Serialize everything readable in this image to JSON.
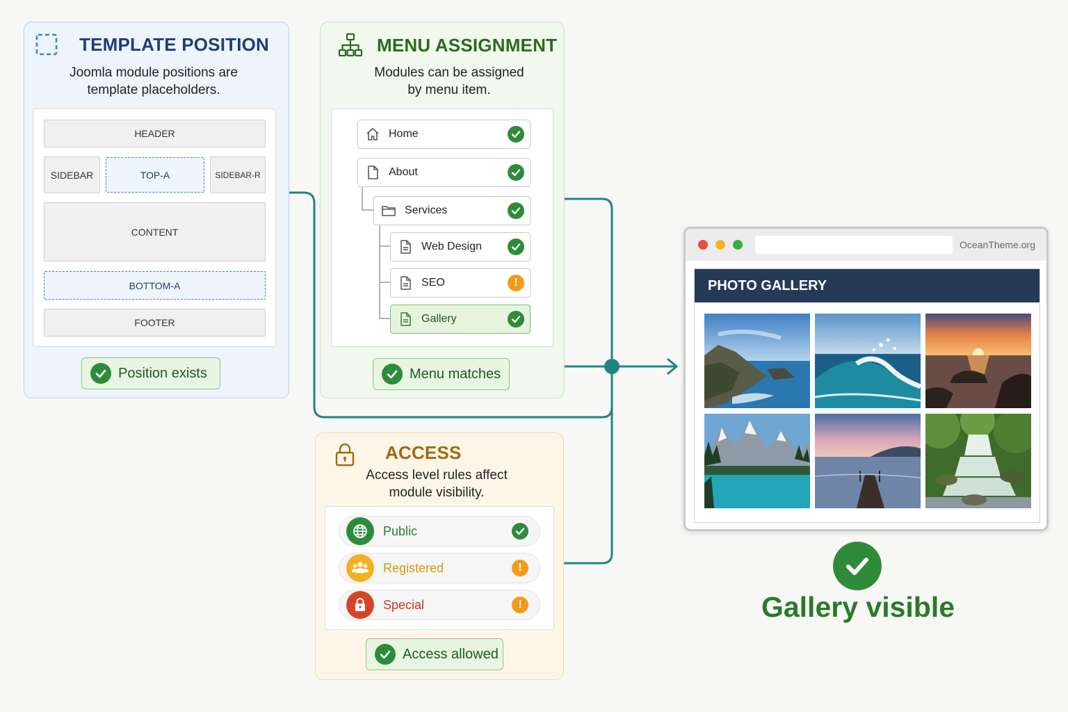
{
  "template_panel": {
    "title": "TEMPLATE POSITION",
    "description_line1": "Joomla module positions are",
    "description_line2": "template placeholders.",
    "slots": {
      "header": "HEADER",
      "sidebar": "SIDEBAR",
      "top_a": "TOP-A",
      "sidebar_r": "SIDEBAR-R",
      "content": "CONTENT",
      "bottom_a": "BOTTOM-A",
      "footer": "FOOTER"
    },
    "status": "Position exists",
    "color": "#1f3f72"
  },
  "menu_panel": {
    "title": "MENU ASSIGNMENT",
    "description_line1": "Modules can be assigned",
    "description_line2": "by menu item.",
    "items": [
      {
        "label": "Home",
        "icon": "home-icon",
        "state": "check"
      },
      {
        "label": "About",
        "icon": "page-icon",
        "state": "check"
      },
      {
        "label": "Services",
        "icon": "folder-icon",
        "state": "check"
      },
      {
        "label": "Web Design",
        "icon": "document-icon",
        "state": "check"
      },
      {
        "label": "SEO",
        "icon": "document-icon",
        "state": "warning"
      },
      {
        "label": "Gallery",
        "icon": "document-icon",
        "state": "check",
        "active": true
      }
    ],
    "status": "Menu matches",
    "color": "#2b6b1e"
  },
  "access_panel": {
    "title": "ACCESS",
    "description_line1": "Access level rules affect",
    "description_line2": "module visibility.",
    "levels": [
      {
        "label": "Public",
        "icon": "globe-icon",
        "state": "check",
        "color": "#2e8b3a"
      },
      {
        "label": "Registered",
        "icon": "users-icon",
        "state": "warning",
        "color": "#e6a313"
      },
      {
        "label": "Special",
        "icon": "lock-icon",
        "state": "warning",
        "color": "#d6452a"
      }
    ],
    "status": "Access allowed",
    "color": "#a06a10"
  },
  "browser": {
    "site_label": "OceanTheme.org",
    "gallery_title": "PHOTO GALLERY",
    "photos": [
      "coastal-cliffs",
      "ocean-wave",
      "sunset-rocks",
      "mountain-lake",
      "pier-dusk",
      "forest-waterfall"
    ]
  },
  "result": {
    "text": "Gallery visible"
  },
  "colors": {
    "connector": "#1f8580",
    "success": "#2e8b3a",
    "warning": "#f39a1a"
  }
}
